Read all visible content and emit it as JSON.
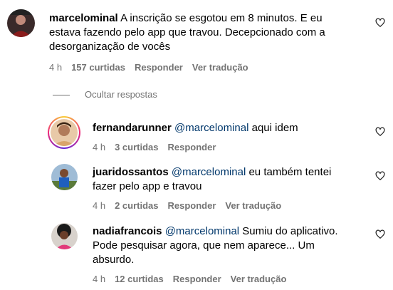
{
  "comments": [
    {
      "username": "marcelominal",
      "text": "A inscrição se esgotou em 8 minutos. E eu estava fazendo pelo app que travou. Decepcionado com a desorganização de vocês",
      "lines": [
        "A inscrição se esgotou em 8 minutos. E eu",
        "estava fazendo pelo app que travou. Decepcionado com a",
        "desorganização de vocês"
      ],
      "time": "4 h",
      "likes": "157 curtidas",
      "reply_label": "Responder",
      "translate_label": "Ver tradução"
    }
  ],
  "hide_replies_label": "Ocultar respostas",
  "replies": [
    {
      "username": "fernandarunner",
      "mention": "@marcelominal",
      "lines": [
        " aqui idem"
      ],
      "time": "4 h",
      "likes": "3 curtidas",
      "reply_label": "Responder"
    },
    {
      "username": "juaridossantos",
      "mention": "@marcelominal",
      "lines": [
        " eu também tentei",
        "fazer pelo app e travou"
      ],
      "time": "4 h",
      "likes": "2 curtidas",
      "reply_label": "Responder",
      "translate_label": "Ver tradução"
    },
    {
      "username": "nadiafrancois",
      "mention": "@marcelominal",
      "lines": [
        " Sumiu do aplicativo.",
        "Pode pesquisar agora, que nem aparece... Um",
        "absurdo."
      ],
      "time": "4 h",
      "likes": "12 curtidas",
      "reply_label": "Responder",
      "translate_label": "Ver tradução"
    }
  ],
  "icons": {
    "like": "heart-outline-icon"
  }
}
